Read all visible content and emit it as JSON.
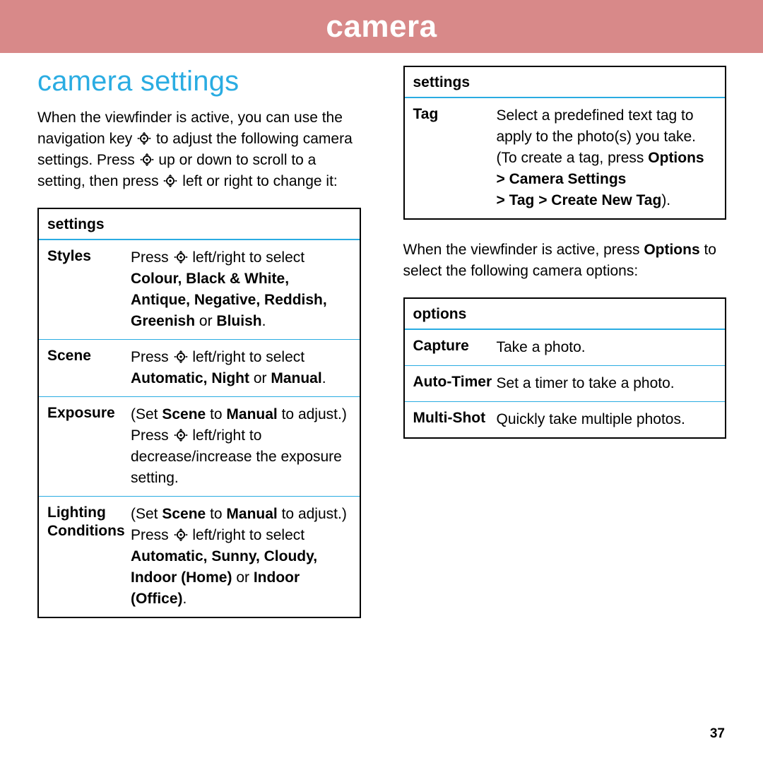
{
  "banner": {
    "title": "camera"
  },
  "section": {
    "title": "camera settings"
  },
  "intro": {
    "p1a": "When the viewfinder is active, you can use the navigation key ",
    "p1b": " to adjust the following camera settings. Press ",
    "p1c": " up or down to scroll to a setting, then press ",
    "p1d": " left or right to change it:"
  },
  "settingsTable": {
    "header": "settings",
    "rows": {
      "styles": {
        "k": "Styles",
        "v1": "Press ",
        "v2": " left/right to select ",
        "opts": "Colour, Black & White, Antique, Negative, Reddish, Greenish",
        "or": " or ",
        "last": "Bluish",
        "dot": "."
      },
      "scene": {
        "k": "Scene",
        "v1": "Press ",
        "v2": " left/right to select ",
        "opts": "Automatic, Night",
        "or": " or ",
        "last": "Manual",
        "dot": "."
      },
      "exposure": {
        "k": "Exposure",
        "pre1": "(Set ",
        "scene": "Scene",
        "pre2": " to ",
        "manual": "Manual",
        "pre3": " to adjust.) Press ",
        "post": " left/right to decrease/increase the exposure setting."
      },
      "lighting": {
        "k1": "Lighting",
        "k2": "Conditions",
        "pre1": "(Set ",
        "scene": "Scene",
        "pre2": " to ",
        "manual": "Manual",
        "pre3": " to adjust.) Press ",
        "mid": " left/right to select ",
        "opts": "Automatic, Sunny, Cloudy, Indoor (Home)",
        "or": " or ",
        "last": "Indoor (Office)",
        "dot": "."
      }
    }
  },
  "settingsTable2": {
    "header": "settings",
    "tag": {
      "k": "Tag",
      "v1": "Select a predefined text tag to apply to the photo(s) you take. (To create a tag, press ",
      "path1": "Options > Camera Settings",
      "path2": "> Tag > Create New Tag",
      "v2": ")."
    }
  },
  "midPara": {
    "a": "When the viewfinder is active, press ",
    "opt": "Options",
    "b": " to select the following camera options:"
  },
  "optionsTable": {
    "header": "options",
    "rows": {
      "capture": {
        "k": "Capture",
        "v": "Take a photo."
      },
      "autotimer": {
        "k": "Auto-Timer",
        "v": "Set a timer to take a photo."
      },
      "multishot": {
        "k": "Multi-Shot",
        "v": "Quickly take multiple photos."
      }
    }
  },
  "page": {
    "num": "37"
  }
}
